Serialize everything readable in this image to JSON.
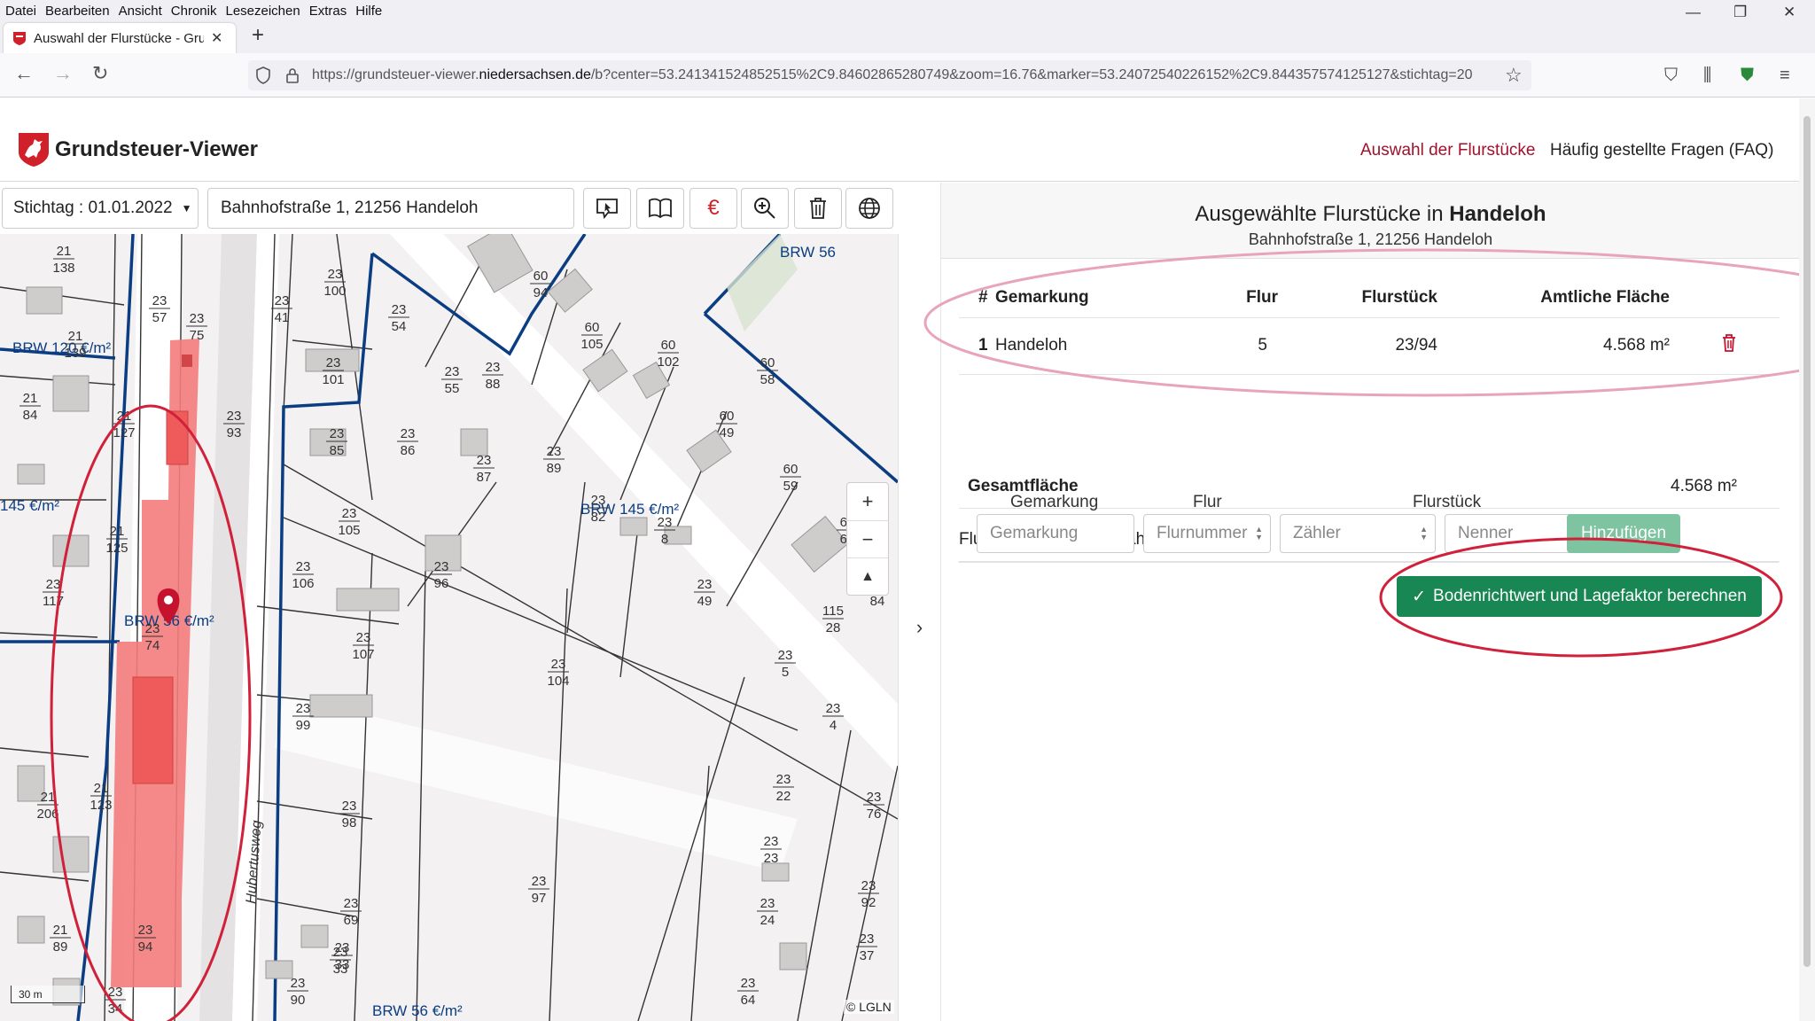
{
  "browser": {
    "menu": [
      "Datei",
      "Bearbeiten",
      "Ansicht",
      "Chronik",
      "Lesezeichen",
      "Extras",
      "Hilfe"
    ],
    "tab_title": "Auswahl der Flurstücke - Grund",
    "url_prefix": "https://grundsteuer-viewer.",
    "url_domain": "niedersachsen.de",
    "url_rest": "/b?center=53.241341524852515%2C9.84602865280749&zoom=16.76&marker=53.24072540226152%2C9.844357574125127&stichtag=20"
  },
  "app": {
    "title": "Grundsteuer-Viewer",
    "nav": {
      "selection": "Auswahl der Flurstücke",
      "faq": "Häufig gestellte Fragen (FAQ)"
    }
  },
  "toolbar": {
    "stichtag": "Stichtag : 01.01.2022",
    "address": "Bahnhofstraße 1, 21256 Handeloh"
  },
  "map": {
    "attribution": "© LGLN",
    "scale": "30 m",
    "brw_labels": [
      "BRW 56",
      "BRW 120 €/m²",
      "145 €/m²",
      "BRW 56 €/m²",
      "BRW 145 €/m²",
      "BRW 56 €/m²"
    ],
    "street": "Hubertusweg",
    "parcels": [
      [
        "21",
        "138"
      ],
      [
        "23",
        "57"
      ],
      [
        "23",
        "75"
      ],
      [
        "23",
        "41"
      ],
      [
        "23",
        "100"
      ],
      [
        "23",
        "54"
      ],
      [
        "60",
        "94"
      ],
      [
        "60",
        "105"
      ],
      [
        "60",
        "102"
      ],
      [
        "21",
        "139"
      ],
      [
        "21",
        "84"
      ],
      [
        "23",
        "101"
      ],
      [
        "23",
        "55"
      ],
      [
        "23",
        "88"
      ],
      [
        "60",
        "58"
      ],
      [
        "23",
        "93"
      ],
      [
        "21",
        "127"
      ],
      [
        "23",
        "85"
      ],
      [
        "23",
        "86"
      ],
      [
        "23",
        "89"
      ],
      [
        "60",
        "49"
      ],
      [
        "23",
        "87"
      ],
      [
        "60",
        "59"
      ],
      [
        "23",
        "82"
      ],
      [
        "23",
        "105"
      ],
      [
        "21",
        "125"
      ],
      [
        "23",
        "8"
      ],
      [
        "60",
        "65"
      ],
      [
        "23",
        "106"
      ],
      [
        "23",
        "96"
      ],
      [
        "23",
        "117"
      ],
      [
        "23",
        "49"
      ],
      [
        "60",
        "84"
      ],
      [
        "115",
        "28"
      ],
      [
        "23",
        "74"
      ],
      [
        "23",
        "107"
      ],
      [
        "23",
        "104"
      ],
      [
        "23",
        "5"
      ],
      [
        "23",
        "99"
      ],
      [
        "23",
        "4"
      ],
      [
        "23",
        "22"
      ],
      [
        "23",
        "98"
      ],
      [
        "23",
        "76"
      ],
      [
        "23",
        "23"
      ],
      [
        "23",
        "97"
      ],
      [
        "23",
        "92"
      ],
      [
        "23",
        "69"
      ],
      [
        "23",
        "24"
      ],
      [
        "23",
        "94"
      ],
      [
        "23",
        "33"
      ],
      [
        "23",
        "37"
      ],
      [
        "21",
        "89"
      ],
      [
        "23",
        "90"
      ],
      [
        "23",
        "64"
      ],
      [
        "23",
        "33"
      ],
      [
        "21",
        "206"
      ],
      [
        "21",
        "123"
      ],
      [
        "23",
        "34"
      ]
    ]
  },
  "panel": {
    "heading_prefix": "Ausgewählte Flurstücke in",
    "heading_place": "Handeloh",
    "subheading": "Bahnhofstraße 1, 21256 Handeloh",
    "columns": [
      "#",
      "Gemarkung",
      "Flur",
      "Flurstück",
      "Amtliche Fläche"
    ],
    "rows": [
      {
        "nr": "1",
        "gemarkung": "Handeloh",
        "flur": "5",
        "flurstueck": "23/94",
        "flaeche": "4.568 m²"
      }
    ],
    "total_label": "Gesamtfläche",
    "total_value": "4.568 m²",
    "quick_title": "Flurstück Schnellauswahl",
    "quick_labels": {
      "gemarkung": "Gemarkung",
      "flur": "Flur",
      "flurstueck": "Flurstück"
    },
    "placeholders": {
      "gemarkung": "Gemarkung",
      "flur": "Flurnummer",
      "zaehler": "Zähler",
      "nenner": "Nenner"
    },
    "add_button": "Hinzufügen",
    "calc_button": "Bodenrichtwert und Lagefaktor berechnen"
  },
  "colors": {
    "accent": "#a0112b",
    "primary_button": "#198754",
    "parcel_highlight": "#f08080",
    "brw_line": "#0b3d82",
    "annotation": "#d0203a",
    "annotation_pink": "#e8a4b8"
  }
}
